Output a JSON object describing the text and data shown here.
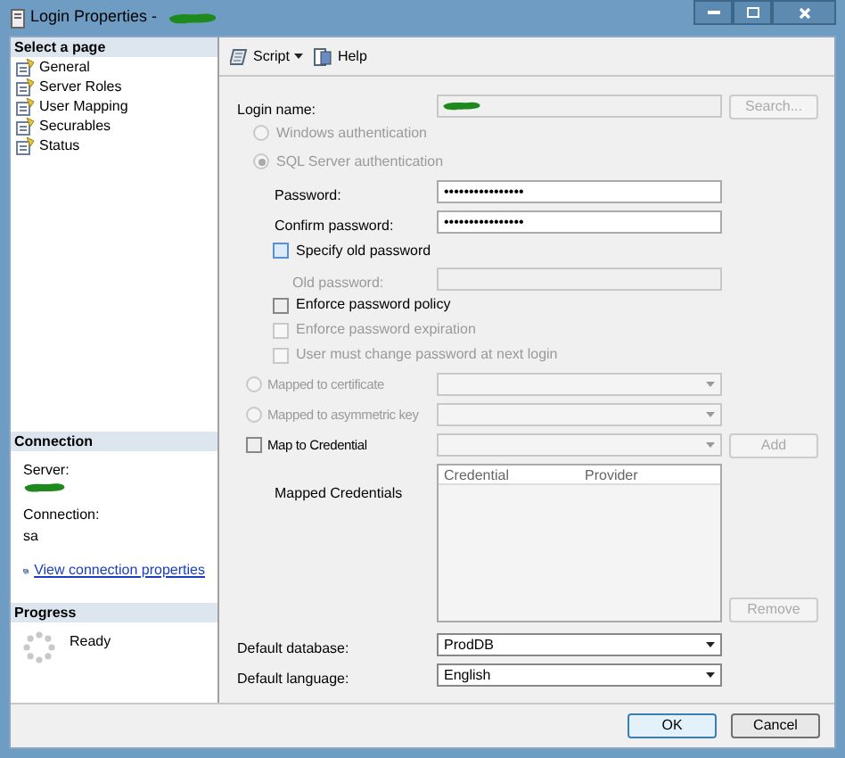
{
  "window": {
    "title": "Login Properties - "
  },
  "sidebar": {
    "header": "Select a page",
    "items": [
      {
        "label": "General"
      },
      {
        "label": "Server Roles"
      },
      {
        "label": "User Mapping"
      },
      {
        "label": "Securables"
      },
      {
        "label": "Status"
      }
    ]
  },
  "connection": {
    "header": "Connection",
    "server_label": "Server:",
    "connection_label": "Connection:",
    "connection_value": "sa",
    "link": "View connection properties"
  },
  "progress": {
    "header": "Progress",
    "status": "Ready"
  },
  "toolbar": [
    {
      "label": "Script",
      "kind": "dropdown"
    },
    {
      "label": "Help",
      "kind": "button"
    }
  ],
  "login_name": {
    "label": "Login name:",
    "search_button": "Search...",
    "search_disabled": true
  },
  "auth_options": [
    {
      "label": "Windows authentication",
      "selected": false,
      "disabled": true
    },
    {
      "label": "SQL Server authentication",
      "selected": true,
      "disabled": true
    }
  ],
  "password_fields": [
    {
      "label": "Password:",
      "value": "••••••••••••••••"
    },
    {
      "label": "Confirm password:",
      "value": "••••••••••••••••"
    }
  ],
  "specify_old_password": {
    "label": "Specify old password",
    "checked": false,
    "disabled": false
  },
  "old_password": {
    "label": "Old password:",
    "disabled": true
  },
  "policy_options": [
    {
      "label": "Enforce password policy",
      "checked": false,
      "disabled": false
    },
    {
      "label": "Enforce password expiration",
      "checked": false,
      "disabled": true
    },
    {
      "label": "User must change password at next login",
      "checked": false,
      "disabled": true
    }
  ],
  "mapping_options": [
    {
      "label": "Mapped to certificate",
      "kind": "radio",
      "selected": false,
      "disabled": true
    },
    {
      "label": "Mapped to asymmetric key",
      "kind": "radio",
      "selected": false,
      "disabled": true
    },
    {
      "label": "Map to Credential",
      "kind": "checkbox",
      "checked": false,
      "disabled": false
    }
  ],
  "add_button": {
    "label": "Add",
    "disabled": true
  },
  "mapped_credentials": {
    "label": "Mapped Credentials",
    "columns": [
      "Credential",
      "Provider"
    ]
  },
  "remove_button": {
    "label": "Remove",
    "disabled": true
  },
  "defaults": [
    {
      "label": "Default database:",
      "value": "ProdDB"
    },
    {
      "label": "Default language:",
      "value": "English"
    }
  ],
  "buttons": [
    {
      "label": "OK",
      "default": true
    },
    {
      "label": "Cancel",
      "default": false
    }
  ]
}
